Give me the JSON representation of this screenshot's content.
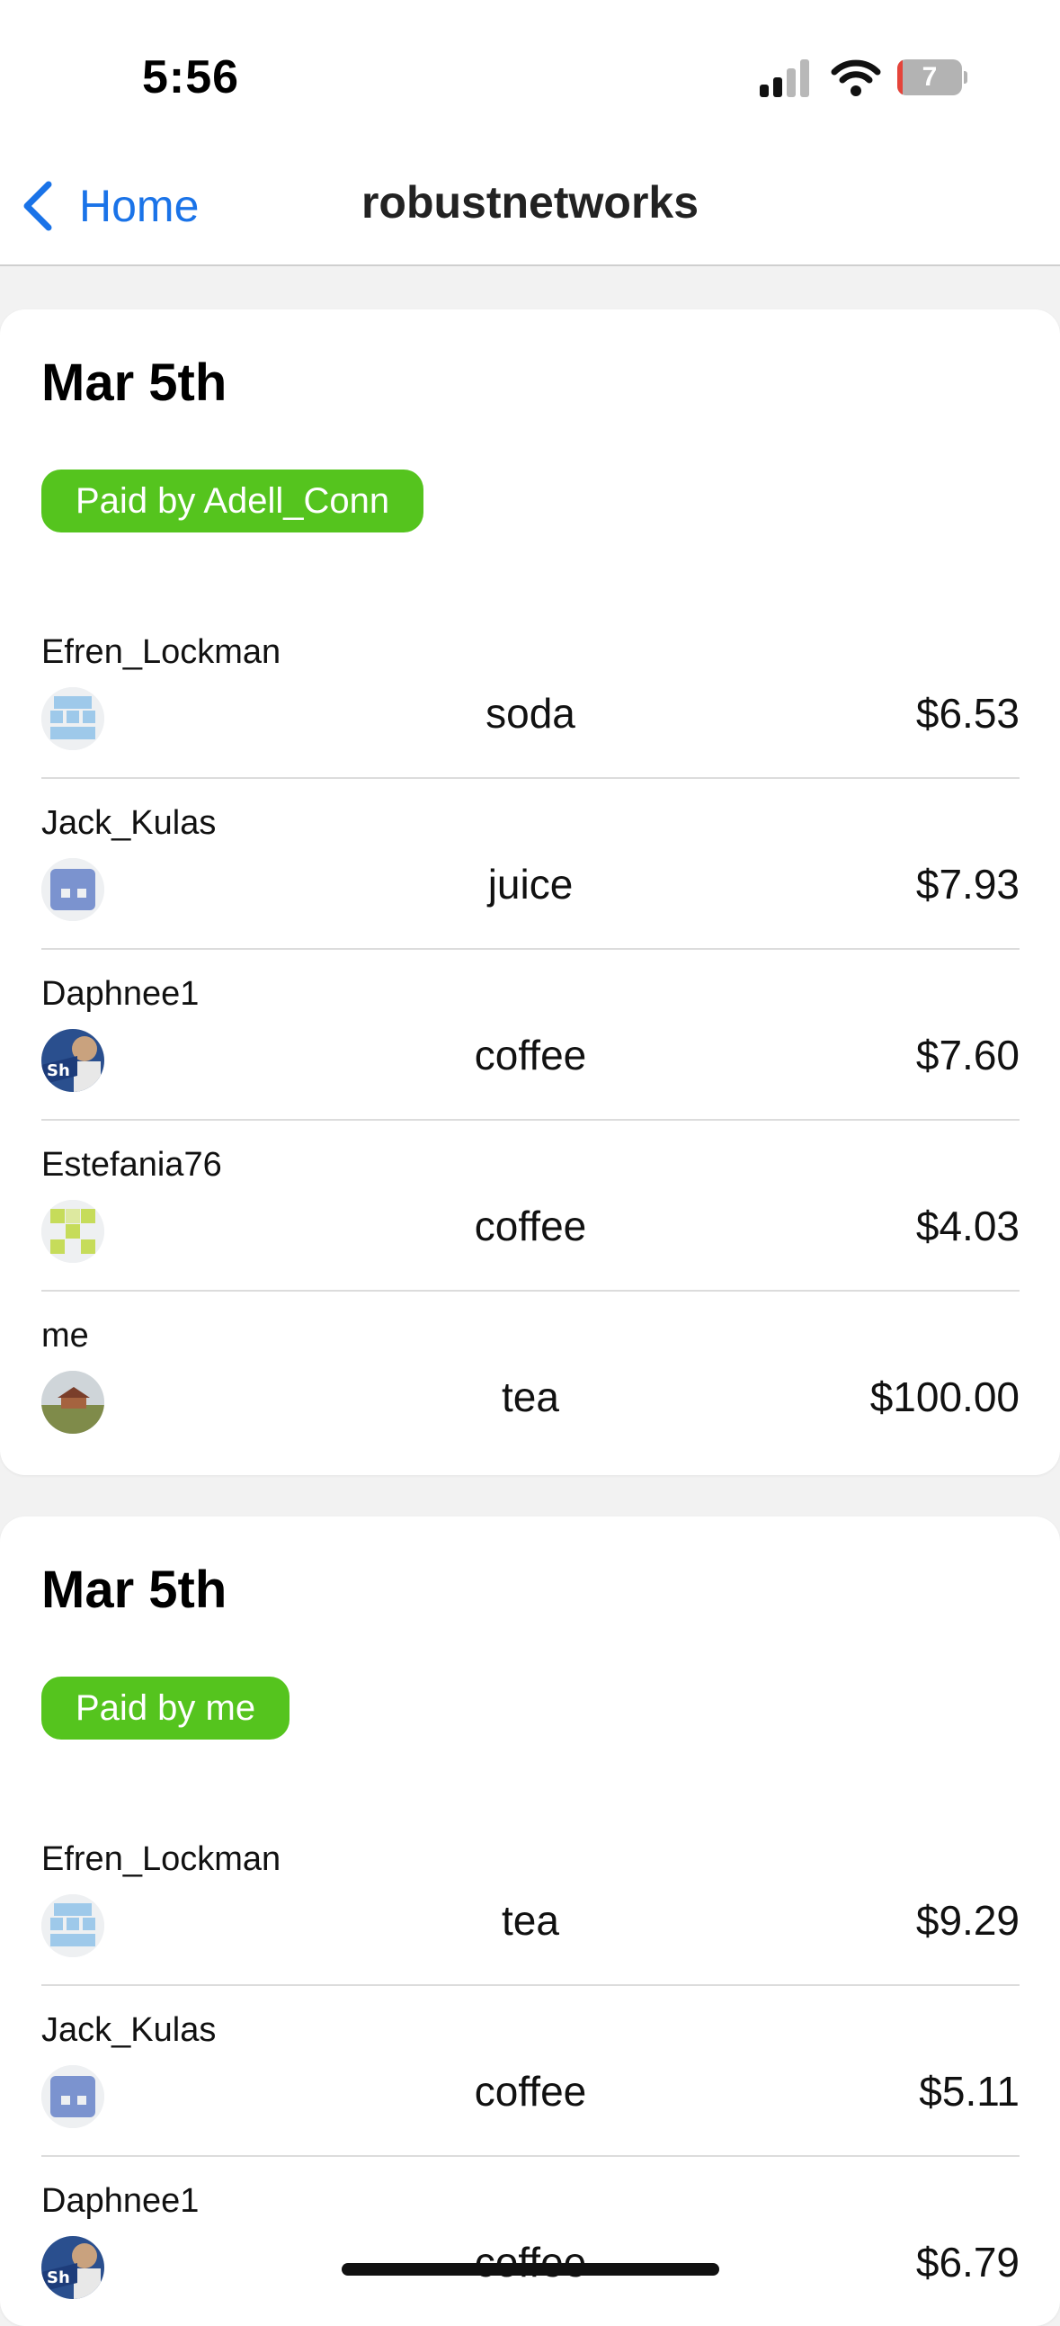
{
  "status_bar": {
    "time": "5:56",
    "battery": "7"
  },
  "nav": {
    "back_label": "Home",
    "title": "robustnetworks"
  },
  "cards": [
    {
      "date": "Mar 5th",
      "paid_by": "Paid by Adell_Conn",
      "rows": [
        {
          "name": "Efren_Lockman",
          "item": "soda",
          "amount": "$6.53"
        },
        {
          "name": "Jack_Kulas",
          "item": "juice",
          "amount": "$7.93"
        },
        {
          "name": "Daphnee1",
          "item": "coffee",
          "amount": "$7.60"
        },
        {
          "name": "Estefania76",
          "item": "coffee",
          "amount": "$4.03"
        },
        {
          "name": "me",
          "item": "tea",
          "amount": "$100.00"
        }
      ]
    },
    {
      "date": "Mar 5th",
      "paid_by": "Paid by me",
      "rows": [
        {
          "name": "Efren_Lockman",
          "item": "tea",
          "amount": "$9.29"
        },
        {
          "name": "Jack_Kulas",
          "item": "coffee",
          "amount": "$5.11"
        },
        {
          "name": "Daphnee1",
          "item": "coffee",
          "amount": "$6.79"
        }
      ]
    }
  ],
  "colors": {
    "accent": "#1a73e8",
    "paid_badge": "#55c41e"
  }
}
